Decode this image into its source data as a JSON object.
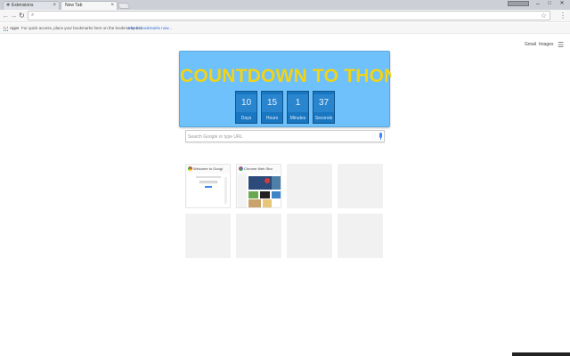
{
  "browser": {
    "tabs": [
      {
        "label": "Extensions",
        "icon": "puzzle-icon",
        "active": false
      },
      {
        "label": "New Tab",
        "icon": "",
        "active": true
      }
    ],
    "omnibox": {
      "value": "",
      "placeholder": ""
    },
    "window_controls": {
      "minimize": "–",
      "maximize": "□",
      "close": "✕"
    }
  },
  "bookmarks_bar": {
    "apps_label": "Apps",
    "message": "For quick access, place your bookmarks here on the bookmarks bar.",
    "import_link": "Import bookmarks now..."
  },
  "ntp": {
    "gmail_link": "Gmail",
    "images_link": "Images"
  },
  "countdown": {
    "title": "COUNTDOWN TO THON",
    "units": [
      {
        "value": "10",
        "label": "Days"
      },
      {
        "value": "15",
        "label": "Hours"
      },
      {
        "value": "1",
        "label": "Minutes"
      },
      {
        "value": "37",
        "label": "Seconds"
      }
    ],
    "colors": {
      "background": "#6ec1fb",
      "title": "#f2d316",
      "box": "#1977c2"
    }
  },
  "search": {
    "placeholder": "Search Google or type URL"
  },
  "most_visited": [
    {
      "title": "Welcome to Googl",
      "favicon": "chrome-icon"
    },
    {
      "title": "Chrome Web Stor",
      "favicon": "webstore-icon"
    }
  ]
}
